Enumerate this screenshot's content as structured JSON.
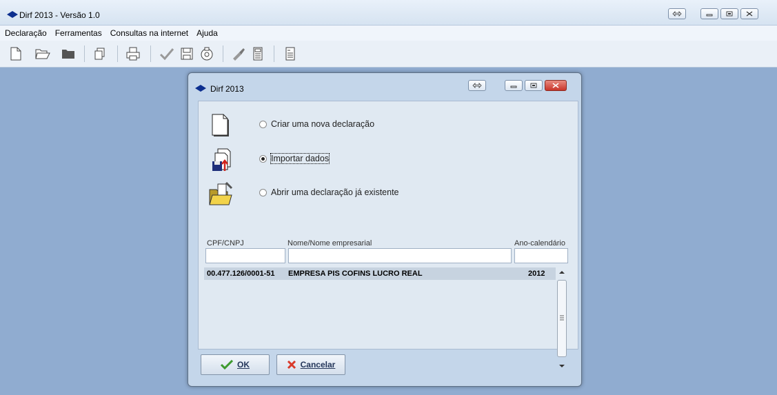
{
  "app": {
    "title": "Dirf 2013 - Versão 1.0"
  },
  "menu": {
    "items": [
      "Declaração",
      "Ferramentas",
      "Consultas na internet",
      "Ajuda"
    ]
  },
  "toolbar": {
    "icons": [
      "new-file-icon",
      "open-folder-icon",
      "folder-icon",
      "copy-icon",
      "print-icon",
      "check-icon",
      "save-icon",
      "disk-icon",
      "tool-icon",
      "calculator-icon",
      "notes-icon"
    ]
  },
  "dialog": {
    "title": "Dirf 2013",
    "options": [
      {
        "label": "Criar uma nova declaração",
        "selected": false
      },
      {
        "label": "Importar dados",
        "selected": true
      },
      {
        "label": "Abrir uma declaração já existente",
        "selected": false
      }
    ],
    "columns": {
      "cpf": "CPF/CNPJ",
      "nome": "Nome/Nome empresarial",
      "ano": "Ano-calendário"
    },
    "filters": {
      "cpf": "",
      "nome": "",
      "ano": ""
    },
    "rows": [
      {
        "cpf": "00.477.126/0001-51",
        "nome": "EMPRESA PIS COFINS LUCRO REAL",
        "ano": "2012"
      }
    ],
    "ok_label": "OK",
    "cancel_label": "Cancelar"
  },
  "colors": {
    "desktop": "#90acd0",
    "dialog_frame": "#c4d6ea",
    "close_button": "#d9453a"
  }
}
